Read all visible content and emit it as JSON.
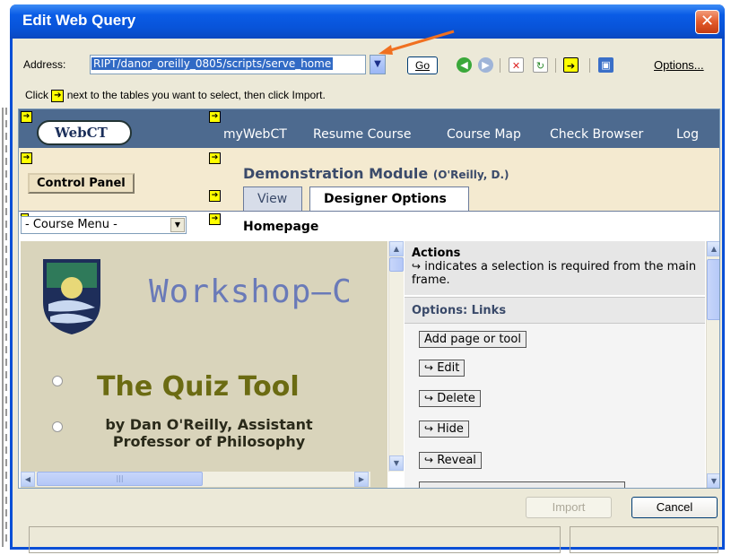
{
  "dialog": {
    "title": "Edit Web Query",
    "close_label": "✕"
  },
  "toolbar": {
    "address_label": "Address:",
    "address_value": "RIPT/danor_oreilly_0805/scripts/serve_home",
    "go_label": "Go",
    "options_label": "Options...",
    "icons": [
      "back-icon",
      "forward-icon",
      "stop-icon",
      "refresh-icon",
      "import-selected-icon",
      "save-query-icon"
    ]
  },
  "instruction": {
    "prefix": "Click",
    "suffix": "next to the tables you want to select, then click Import."
  },
  "webpage": {
    "logo_text": "WebCT",
    "nav_links": [
      "myWebCT",
      "Resume Course",
      "Course Map",
      "Check Browser",
      "Log"
    ],
    "control_panel_label": "Control Panel",
    "module_title": "Demonstration Module",
    "module_owner": "(O'Reilly, D.)",
    "tabs": [
      "View",
      "Designer Options"
    ],
    "course_menu_value": "- Course Menu -",
    "homepage_label": "Homepage",
    "workshop_text": "Workshop—C",
    "quiz_title": "The Quiz Tool",
    "byline": "by Dan O'Reilly, Assistant Professor of Philosophy"
  },
  "actions_panel": {
    "title": "Actions",
    "description": "indicates a selection is required from the main frame.",
    "options_title": "Options: Links",
    "buttons": [
      "Add page or tool",
      "Edit",
      "Delete",
      "Hide",
      "Reveal"
    ]
  },
  "footer": {
    "import_label": "Import",
    "cancel_label": "Cancel"
  },
  "colors": {
    "titlebar": "#0a5ce6",
    "navbar": "#4d6a8f",
    "accent_marker": "#ffff00",
    "annotation_arrow": "#f07020"
  }
}
